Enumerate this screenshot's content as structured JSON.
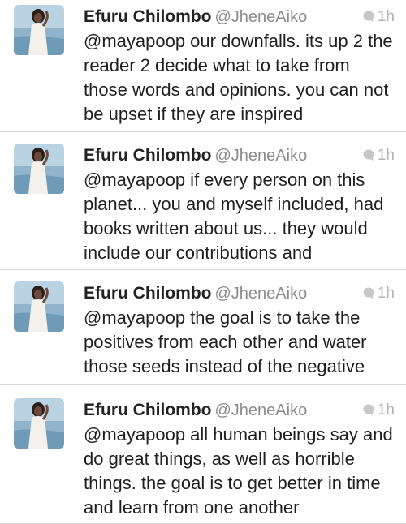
{
  "tweets": [
    {
      "name": "Efuru Chilombo",
      "handle": "@JheneAiko",
      "time": "1h",
      "text": "@mayapoop our downfalls. its up 2 the reader 2 decide what to take from those words and opinions. you can not be upset if they are inspired"
    },
    {
      "name": "Efuru Chilombo",
      "handle": "@JheneAiko",
      "time": "1h",
      "text": "@mayapoop if every person on this planet... you and myself included, had books written about us... they would include our contributions and"
    },
    {
      "name": "Efuru Chilombo",
      "handle": "@JheneAiko",
      "time": "1h",
      "text": "@mayapoop the goal is to take the positives from each other and water those seeds instead of the negative"
    },
    {
      "name": "Efuru Chilombo",
      "handle": "@JheneAiko",
      "time": "1h",
      "text": "@mayapoop all human beings say and do great things, as well as horrible things. the goal is to get better in time and learn from one another"
    }
  ]
}
